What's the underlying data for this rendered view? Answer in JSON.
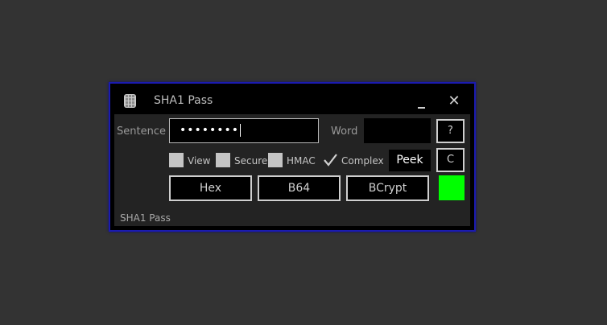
{
  "window": {
    "title": "SHA1 Pass",
    "minimize_label": "_",
    "close_label": "✕",
    "border_color": "#1b1bb0",
    "app_icon": "calculator-icon"
  },
  "form": {
    "sentence_label": "Sentence",
    "sentence_value": "••••••••",
    "word_label": "Word",
    "word_value": "",
    "help_button": "?",
    "clear_button": "C",
    "peek_button": "Peek"
  },
  "options": [
    {
      "label": "View",
      "checked": false
    },
    {
      "label": "Secure",
      "checked": false
    },
    {
      "label": "HMAC",
      "checked": false
    },
    {
      "label": "Complex",
      "checked": true
    }
  ],
  "buttons": {
    "hex": "Hex",
    "b64": "B64",
    "bcrypt": "BCrypt"
  },
  "status": {
    "color": "#00ff00"
  },
  "footer": {
    "text": "SHA1 Pass"
  }
}
